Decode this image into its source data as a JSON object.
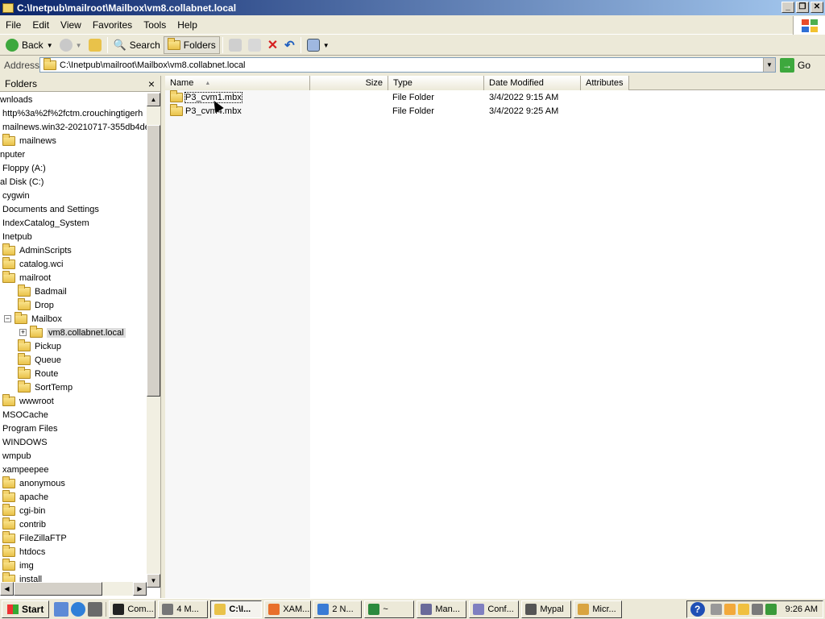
{
  "window": {
    "title": "C:\\Inetpub\\mailroot\\Mailbox\\vm8.collabnet.local"
  },
  "menu": [
    "File",
    "Edit",
    "View",
    "Favorites",
    "Tools",
    "Help"
  ],
  "toolbar": {
    "back": "Back",
    "search": "Search",
    "folders": "Folders"
  },
  "address": {
    "label": "Address",
    "value": "C:\\Inetpub\\mailroot\\Mailbox\\vm8.collabnet.local",
    "go": "Go"
  },
  "folders_pane": {
    "title": "Folders",
    "close": "×",
    "items": [
      {
        "label": "wnloads",
        "indent": 0,
        "folder": false
      },
      {
        "label": "http%3a%2f%2fctm.crouchingtigerh",
        "indent": 1,
        "folder": false
      },
      {
        "label": "mailnews.win32-20210717-355db4de",
        "indent": 1,
        "folder": false
      },
      {
        "label": "mailnews",
        "indent": 1,
        "folder": true
      },
      {
        "label": "nputer",
        "indent": 0,
        "folder": false
      },
      {
        "label": "Floppy (A:)",
        "indent": 1,
        "folder": false
      },
      {
        "label": "al Disk (C:)",
        "indent": 0,
        "folder": false
      },
      {
        "label": "cygwin",
        "indent": 1,
        "folder": false
      },
      {
        "label": "Documents and Settings",
        "indent": 1,
        "folder": false
      },
      {
        "label": "IndexCatalog_System",
        "indent": 1,
        "folder": false
      },
      {
        "label": "Inetpub",
        "indent": 1,
        "folder": false
      },
      {
        "label": "AdminScripts",
        "indent": 2,
        "folder": true
      },
      {
        "label": "catalog.wci",
        "indent": 2,
        "folder": true
      },
      {
        "label": "mailroot",
        "indent": 2,
        "folder": true
      },
      {
        "label": "Badmail",
        "indent": 3,
        "folder": true
      },
      {
        "label": "Drop",
        "indent": 3,
        "folder": true
      },
      {
        "label": "Mailbox",
        "indent": 3,
        "folder": true,
        "expander": "−"
      },
      {
        "label": "vm8.collabnet.local",
        "indent": 4,
        "folder": true,
        "expander": "+",
        "selected": true
      },
      {
        "label": "Pickup",
        "indent": 3,
        "folder": true
      },
      {
        "label": "Queue",
        "indent": 3,
        "folder": true
      },
      {
        "label": "Route",
        "indent": 3,
        "folder": true
      },
      {
        "label": "SortTemp",
        "indent": 3,
        "folder": true
      },
      {
        "label": "wwwroot",
        "indent": 2,
        "folder": true
      },
      {
        "label": "MSOCache",
        "indent": 1,
        "folder": false
      },
      {
        "label": "Program Files",
        "indent": 1,
        "folder": false
      },
      {
        "label": "WINDOWS",
        "indent": 1,
        "folder": false
      },
      {
        "label": "wmpub",
        "indent": 1,
        "folder": false
      },
      {
        "label": "xampeepee",
        "indent": 1,
        "folder": false
      },
      {
        "label": "anonymous",
        "indent": 2,
        "folder": true
      },
      {
        "label": "apache",
        "indent": 2,
        "folder": true
      },
      {
        "label": "cgi-bin",
        "indent": 2,
        "folder": true
      },
      {
        "label": "contrib",
        "indent": 2,
        "folder": true
      },
      {
        "label": "FileZillaFTP",
        "indent": 2,
        "folder": true
      },
      {
        "label": "htdocs",
        "indent": 2,
        "folder": true
      },
      {
        "label": "img",
        "indent": 2,
        "folder": true
      },
      {
        "label": "install",
        "indent": 2,
        "folder": true
      }
    ]
  },
  "list": {
    "columns": [
      "Name",
      "Size",
      "Type",
      "Date Modified",
      "Attributes"
    ],
    "sort_indicator": "▲",
    "rows": [
      {
        "name": "P3_cvm1.mbx",
        "size": "",
        "type": "File Folder",
        "date": "3/4/2022 9:15 AM",
        "attributes": ""
      },
      {
        "name": "P3_cvm4.mbx",
        "size": "",
        "type": "File Folder",
        "date": "3/4/2022 9:25 AM",
        "attributes": ""
      }
    ]
  },
  "taskbar": {
    "start": "Start",
    "tasks": [
      {
        "label": "Com...",
        "color": "#222"
      },
      {
        "label": "4 M...",
        "color": "#777"
      },
      {
        "label": "C:\\I...",
        "color": "#e9c24a",
        "active": true
      },
      {
        "label": "XAM...",
        "color": "#e86f2b"
      },
      {
        "label": "2 N...",
        "color": "#3a7bd5"
      },
      {
        "label": "~",
        "color": "#2b8a3e"
      },
      {
        "label": "Man...",
        "color": "#6a6a9a"
      },
      {
        "label": "Conf...",
        "color": "#7f7fc0"
      },
      {
        "label": "Mypal",
        "color": "#555"
      },
      {
        "label": "Micr...",
        "color": "#d9a441"
      }
    ],
    "clock": "9:26 AM"
  }
}
